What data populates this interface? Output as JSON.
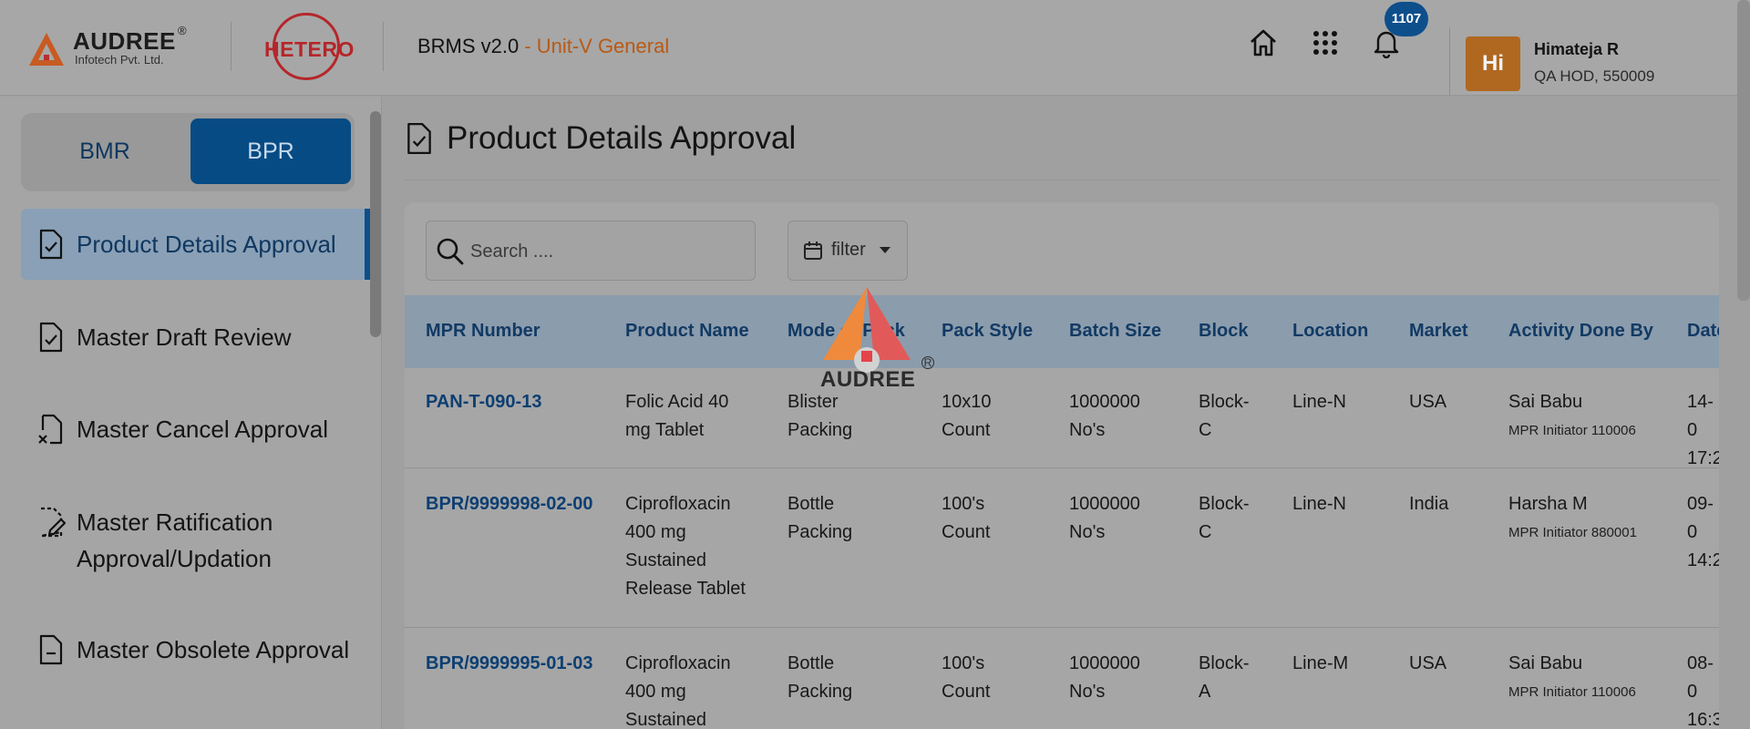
{
  "header": {
    "brand": {
      "name": "AUDREE",
      "reg": "®",
      "sub": "Infotech Pvt. Ltd."
    },
    "partner_logo": "HETERO",
    "app_name": "BRMS v2.0",
    "unit": "- Unit-V General",
    "notification_count": "1107",
    "user": {
      "initials": "Hi",
      "name": "Himateja R",
      "role": "QA HOD, 550009"
    },
    "icons": [
      "home-icon",
      "apps-grid-icon",
      "bell-icon"
    ]
  },
  "sidebar": {
    "toggle": {
      "bmr": "BMR",
      "bpr": "BPR",
      "selected": "BPR"
    },
    "items": [
      {
        "label": "Product Details Approval",
        "icon": "file-check-icon",
        "active": true
      },
      {
        "label": "Master Draft Review",
        "icon": "file-check-icon",
        "active": false
      },
      {
        "label": "Master Cancel Approval",
        "icon": "file-cancel-icon",
        "active": false
      },
      {
        "label": "Master Ratification Approval/Updation",
        "label_line1": "Master Ratification",
        "label_line2": "Approval/Updation",
        "icon": "file-edit-icon",
        "active": false
      },
      {
        "label": "Master Obsolete Approval",
        "icon": "file-minus-icon",
        "active": false
      }
    ]
  },
  "main": {
    "title": "Product Details Approval",
    "search": {
      "placeholder": "Search ....",
      "value": ""
    },
    "filter_label": "filter",
    "columns": [
      "MPR Number",
      "Product Name",
      "Mode of Pack",
      "Pack Style",
      "Batch Size",
      "Block",
      "Location",
      "Market",
      "Activity Done By",
      "Date"
    ],
    "rows": [
      {
        "mpr": "PAN-T-090-13",
        "product": [
          "Folic Acid 40",
          "mg Tablet"
        ],
        "mode": [
          "Blister",
          "Packing"
        ],
        "pack_style": [
          "10x10",
          "Count"
        ],
        "batch": [
          "1000000",
          "No's"
        ],
        "block": [
          "Block-",
          "C"
        ],
        "location": "Line-N",
        "market": "USA",
        "by_name": "Sai Babu",
        "by_role": "MPR Initiator 110006",
        "date": [
          "14-0",
          "17:2"
        ]
      },
      {
        "mpr": "BPR/9999998-02-00",
        "product": [
          "Ciprofloxacin",
          "400 mg",
          "Sustained",
          "Release Tablet"
        ],
        "mode": [
          "Bottle",
          "Packing"
        ],
        "pack_style": [
          "100's",
          "Count"
        ],
        "batch": [
          "1000000",
          "No's"
        ],
        "block": [
          "Block-",
          "C"
        ],
        "location": "Line-N",
        "market": "India",
        "by_name": "Harsha M",
        "by_role": "MPR Initiator 880001",
        "date": [
          "09-0",
          "14:2"
        ]
      },
      {
        "mpr": "BPR/9999995-01-03",
        "product": [
          "Ciprofloxacin",
          "400 mg",
          "Sustained"
        ],
        "mode": [
          "Bottle",
          "Packing"
        ],
        "pack_style": [
          "100's",
          "Count"
        ],
        "batch": [
          "1000000",
          "No's"
        ],
        "block": [
          "Block-",
          "A"
        ],
        "location": "Line-M",
        "market": "USA",
        "by_name": "Sai Babu",
        "by_role": "MPR Initiator 110006",
        "date": [
          "08-0",
          "16:3"
        ]
      }
    ]
  },
  "watermark": {
    "word": "AUDREE",
    "reg": "R"
  }
}
